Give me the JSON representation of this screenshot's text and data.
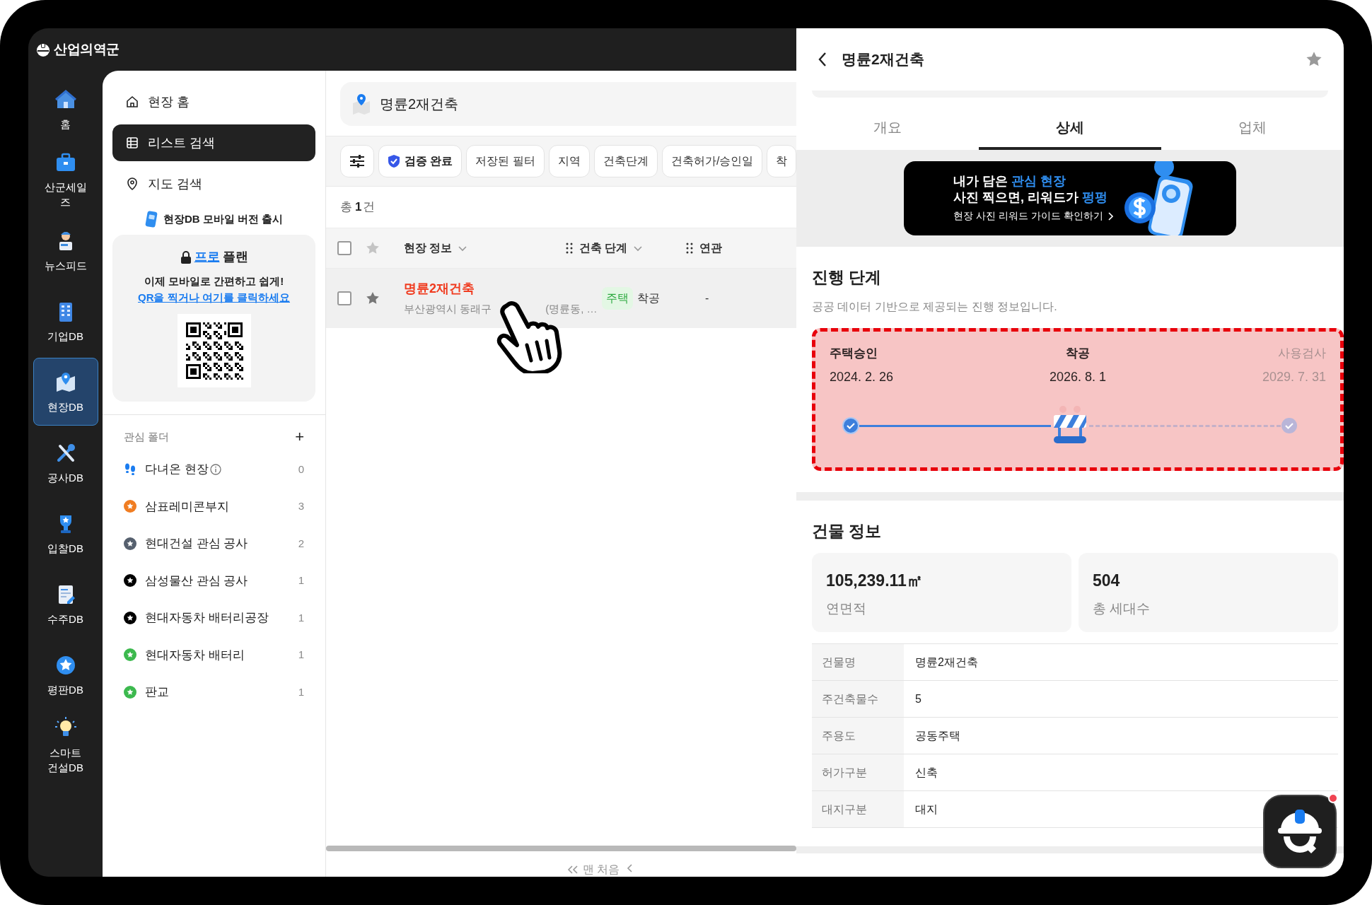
{
  "app": {
    "logo": "산업의역군"
  },
  "rail": [
    {
      "label": "홈",
      "selected": false
    },
    {
      "label": "산군세일즈",
      "selected": false
    },
    {
      "label": "뉴스피드",
      "selected": false
    },
    {
      "label": "기업DB",
      "selected": false
    },
    {
      "label": "현장DB",
      "selected": true
    },
    {
      "label": "공사DB",
      "selected": false
    },
    {
      "label": "입찰DB",
      "selected": false
    },
    {
      "label": "수주DB",
      "selected": false
    },
    {
      "label": "평판DB",
      "selected": false
    },
    {
      "label": "스마트 건설DB",
      "selected": false
    }
  ],
  "subnav": {
    "items": [
      {
        "label": "현장 홈",
        "selected": false
      },
      {
        "label": "리스트 검색",
        "selected": true
      },
      {
        "label": "지도 검색",
        "selected": false
      }
    ],
    "mobile_notice": "현장DB 모바일 버전 출시",
    "promo": {
      "highlight": "프로",
      "title": "플랜",
      "line": "이제 모바일로 간편하고 쉽게!",
      "link": "QR을 찍거나 여기를 클릭하세요"
    }
  },
  "folders": {
    "title": "관심 폴더",
    "add": "+",
    "items": [
      {
        "kind": "visited",
        "name": "다녀온 현장",
        "count": "0"
      },
      {
        "kind": "folder",
        "name": "삼표레미콘부지",
        "count": "3",
        "color": "#f07d22"
      },
      {
        "kind": "folder",
        "name": "현대건설 관심 공사",
        "count": "2",
        "color": "#56606e"
      },
      {
        "kind": "folder",
        "name": "삼성물산 관심 공사",
        "count": "1",
        "color": "#000000"
      },
      {
        "kind": "folder",
        "name": "현대자동차 배터리공장",
        "count": "1",
        "color": "#000000"
      },
      {
        "kind": "folder",
        "name": "현대자동차 배터리",
        "count": "1",
        "color": "#3cb94e"
      },
      {
        "kind": "folder",
        "name": "판교",
        "count": "1",
        "color": "#3cb94e"
      }
    ]
  },
  "search": {
    "value": "명륜2재건축"
  },
  "filters": [
    {
      "kind": "settings"
    },
    {
      "kind": "verified",
      "label": "검증 완료"
    },
    {
      "kind": "chip",
      "label": "저장된 필터"
    },
    {
      "kind": "chip",
      "label": "지역"
    },
    {
      "kind": "chip",
      "label": "건축단계"
    },
    {
      "kind": "chip",
      "label": "건축허가/승인일"
    },
    {
      "kind": "chip",
      "label": "착"
    }
  ],
  "result_count": {
    "prefix": "총",
    "count": "1",
    "suffix": "건"
  },
  "table": {
    "select_all_checked": false,
    "columns": [
      {
        "label": "현장 정보",
        "kind": "sort"
      },
      {
        "label": "건축 단계",
        "kind": "dragsort"
      },
      {
        "label": "연관",
        "kind": "drag"
      }
    ],
    "rows": [
      {
        "checked": false,
        "name": "명륜2재건축",
        "address_start": "부산광역시 동래구",
        "address_end": "(명륜동, …",
        "tag": "주택",
        "stage": "착공",
        "related": "-"
      }
    ]
  },
  "pagination": {
    "first": "맨 처음"
  },
  "detail": {
    "title": "명륜2재건축",
    "favorite": false,
    "tabs": [
      {
        "label": "개요",
        "selected": false
      },
      {
        "label": "상세",
        "selected": true
      },
      {
        "label": "업체",
        "selected": false
      }
    ],
    "banner": {
      "lines": [
        [
          {
            "text": "내가 담은 ",
            "highlight": false
          },
          {
            "text": "관심 현장",
            "highlight": true
          }
        ],
        [
          {
            "text": "사진 찍으면, 리워드가 ",
            "highlight": false
          },
          {
            "text": "펑펑",
            "highlight": true
          }
        ]
      ],
      "link": "현장 사진 리워드 가이드 확인하기"
    },
    "progress": {
      "title": "진행 단계",
      "subtitle": "공공 데이터 기반으로 제공되는 진행 정보입니다.",
      "steps": [
        {
          "name": "주택승인",
          "date": "2024. 2. 26",
          "kind": "done"
        },
        {
          "name": "착공",
          "date": "2026. 8. 1",
          "kind": "current"
        },
        {
          "name": "사용검사",
          "date": "2029. 7. 31",
          "kind": "upcoming"
        }
      ]
    },
    "building": {
      "title": "건물 정보",
      "stats": [
        {
          "value": "105,239.11㎡",
          "label": "연면적"
        },
        {
          "value": "504",
          "label": "총 세대수"
        }
      ],
      "rows": [
        {
          "label": "건물명",
          "value": "명륜2재건축"
        },
        {
          "label": "주건축물수",
          "value": "5"
        },
        {
          "label": "주용도",
          "value": "공동주택"
        },
        {
          "label": "허가구분",
          "value": "신축"
        },
        {
          "label": "대지구분",
          "value": "대지"
        }
      ]
    }
  },
  "chat": {
    "has_notification": true
  }
}
